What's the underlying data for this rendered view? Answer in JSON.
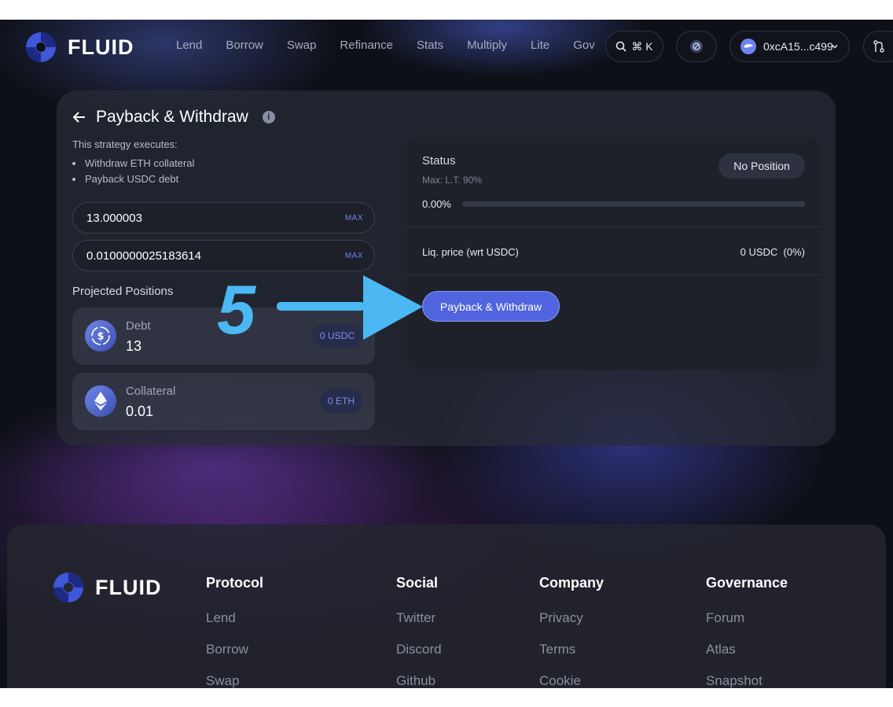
{
  "header": {
    "logo_text": "FLUID",
    "nav": [
      "Lend",
      "Borrow",
      "Swap",
      "Refinance",
      "Stats",
      "Multiply",
      "Lite",
      "Gov"
    ],
    "search_shortcut": "⌘ K",
    "wallet_address": "0xcA15...c499"
  },
  "panel": {
    "title": "Payback & Withdraw",
    "info_icon": "i",
    "description": "This strategy executes:",
    "steps": [
      "Withdraw ETH collateral",
      "Payback USDC debt"
    ],
    "inputs": [
      {
        "value": "13.000003",
        "max_label": "MAX"
      },
      {
        "value": "0.0100000025183614",
        "max_label": "MAX"
      }
    ],
    "projected_label": "Projected Positions",
    "positions": [
      {
        "label": "Debt",
        "value": "13",
        "badge": "0 USDC",
        "icon": "usdc-icon"
      },
      {
        "label": "Collateral",
        "value": "0.01",
        "badge": "0 ETH",
        "icon": "eth-icon"
      }
    ]
  },
  "status": {
    "title": "Status",
    "max_note": "Max: L.T. 90%",
    "position_badge": "No Position",
    "percent_text": "0.00%",
    "percent_value": 0,
    "liq_label": "Liq. price (wrt USDC)",
    "liq_value": "0 USDC  (0%)",
    "action_button": "Payback & Withdraw"
  },
  "annotation": {
    "step_number": "5",
    "color": "#4cb8f3"
  },
  "footer": {
    "logo_text": "FLUID",
    "columns": [
      {
        "title": "Protocol",
        "links": [
          "Lend",
          "Borrow",
          "Swap"
        ]
      },
      {
        "title": "Social",
        "links": [
          "Twitter",
          "Discord",
          "Github"
        ]
      },
      {
        "title": "Company",
        "links": [
          "Privacy",
          "Terms",
          "Cookie"
        ]
      },
      {
        "title": "Governance",
        "links": [
          "Forum",
          "Atlas",
          "Snapshot"
        ]
      }
    ]
  },
  "colors": {
    "accent": "#5064e0",
    "background": "#0e1017"
  }
}
